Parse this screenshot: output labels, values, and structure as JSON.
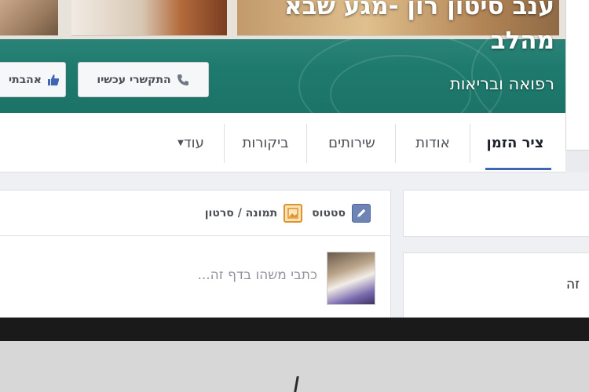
{
  "cover": {
    "page_name": "ענב סיטון רון -מגע שבא מהלב",
    "category": "רפואה ובריאות",
    "buttons": {
      "call_now": "התקשרי עכשיו",
      "like": "אהבתי",
      "call_icon": "phone-icon",
      "like_icon": "thumbs-up-icon"
    }
  },
  "tabs": [
    {
      "label": "ציר הזמן",
      "active": true
    },
    {
      "label": "אודות"
    },
    {
      "label": "שירותים"
    },
    {
      "label": "ביקורות"
    },
    {
      "label": "עוד"
    }
  ],
  "composer": {
    "actions": {
      "status": "סטטוס",
      "photo_video": "תמונה / סרטון",
      "status_icon": "pencil-icon",
      "photo_icon": "photo-icon"
    },
    "placeholder": "כתבי משהו בדף זה..."
  },
  "side": {
    "partial_text": "זה"
  },
  "colors": {
    "cover_teal": "#1f7a6e",
    "accent_blue": "#4267b2",
    "photo_orange": "#e0922d"
  }
}
